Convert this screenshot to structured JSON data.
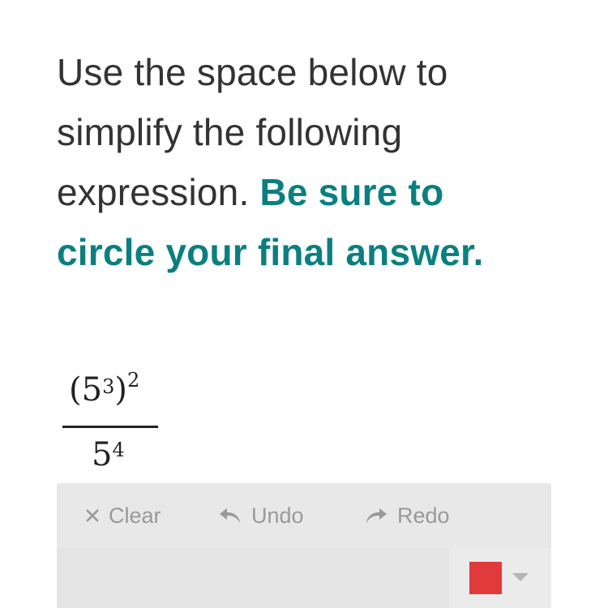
{
  "instructions": {
    "plain": "Use the space below to simplify the following expression.",
    "emphasis": "Be sure to circle your final answer."
  },
  "expression": {
    "numerator_base": "5",
    "numerator_inner_exponent": "3",
    "numerator_outer_exponent": "2",
    "denominator_base": "5",
    "denominator_exponent": "4",
    "open_paren": "(",
    "close_paren": ")"
  },
  "toolbar": {
    "clear_label": "Clear",
    "undo_label": "Undo",
    "redo_label": "Redo"
  },
  "icons": {
    "clear": "close-icon",
    "undo": "undo-arrow-icon",
    "redo": "redo-arrow-icon",
    "dropdown": "caret-down-icon"
  },
  "colors": {
    "emphasis": "#0b7f80",
    "pen_color": "#e03a3a",
    "canvas_bg": "#e8e8e8"
  }
}
